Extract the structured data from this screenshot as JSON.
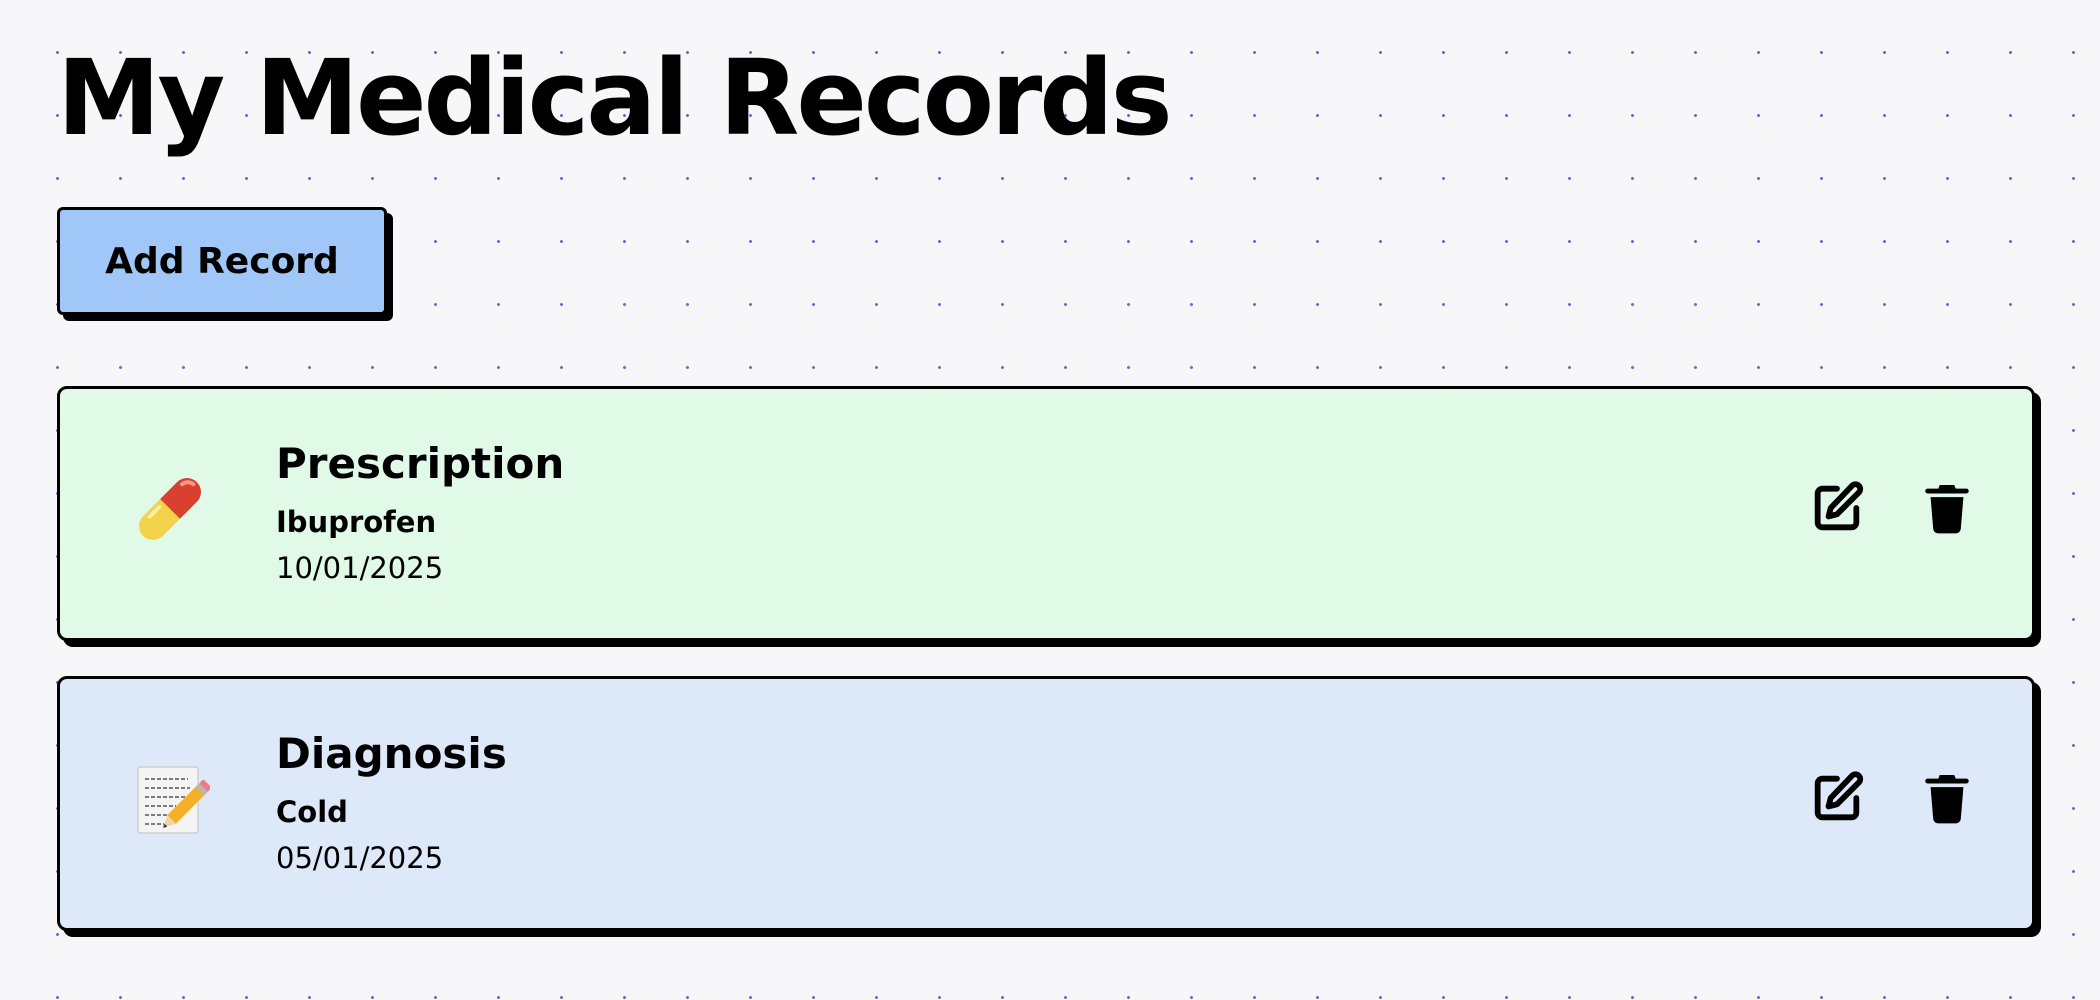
{
  "page": {
    "title": "My Medical Records"
  },
  "toolbar": {
    "add_label": "Add Record"
  },
  "records": [
    {
      "type": "Prescription",
      "name": "Ibuprofen",
      "date": "10/01/2025",
      "icon": "pill-icon",
      "bg_color": "#e1f9e7"
    },
    {
      "type": "Diagnosis",
      "name": "Cold",
      "date": "05/01/2025",
      "icon": "memo-icon",
      "bg_color": "#dde8f9"
    }
  ],
  "actions": {
    "edit_icon": "edit-icon",
    "delete_icon": "trash-icon"
  },
  "colors": {
    "background": "#f7f7f9",
    "button": "#a0c7f8",
    "dots": "#6a63d6"
  }
}
